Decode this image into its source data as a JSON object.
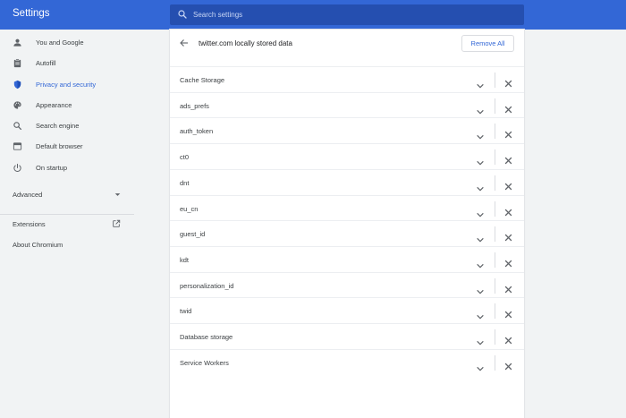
{
  "header": {
    "title": "Settings",
    "search_placeholder": "Search settings"
  },
  "sidebar": {
    "items": [
      {
        "label": "You and Google",
        "icon": "person-icon",
        "active": false
      },
      {
        "label": "Autofill",
        "icon": "clipboard-icon",
        "active": false
      },
      {
        "label": "Privacy and security",
        "icon": "shield-icon",
        "active": true
      },
      {
        "label": "Appearance",
        "icon": "palette-icon",
        "active": false
      },
      {
        "label": "Search engine",
        "icon": "search-icon",
        "active": false
      },
      {
        "label": "Default browser",
        "icon": "browser-icon",
        "active": false
      },
      {
        "label": "On startup",
        "icon": "power-icon",
        "active": false
      }
    ],
    "advanced_label": "Advanced",
    "extensions_label": "Extensions",
    "about_label": "About Chromium"
  },
  "main": {
    "title": "twitter.com locally stored data",
    "remove_all_label": "Remove All",
    "rows": [
      "Cache Storage",
      "ads_prefs",
      "auth_token",
      "ct0",
      "dnt",
      "eu_cn",
      "guest_id",
      "kdt",
      "personalization_id",
      "twid",
      "Database storage",
      "Service Workers"
    ]
  },
  "colors": {
    "accent": "#3367d6",
    "header_bg": "#3367d6",
    "search_bg": "#254fb0",
    "page_bg": "#f1f3f4"
  }
}
